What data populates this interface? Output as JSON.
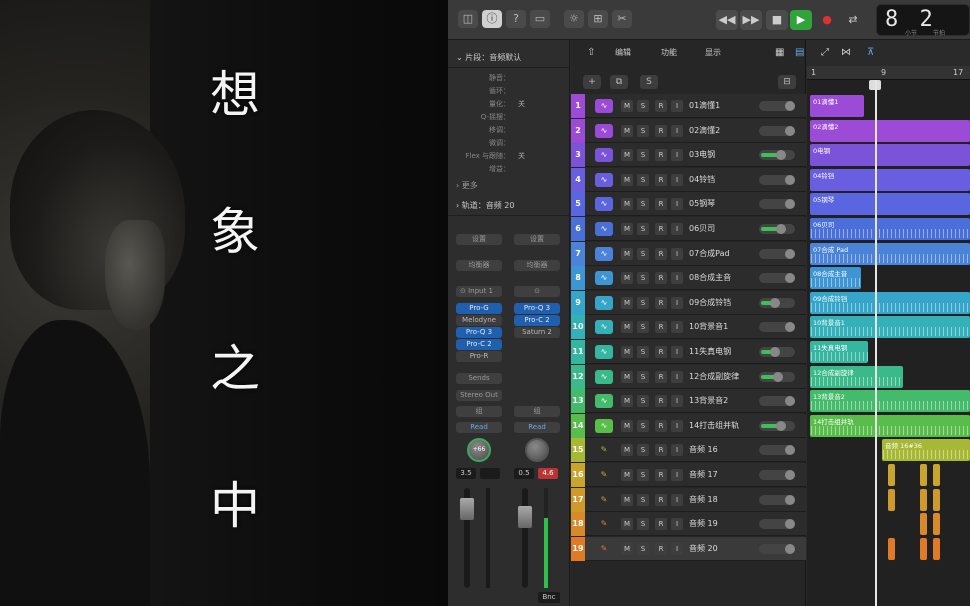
{
  "lyrics": [
    "想",
    "象",
    "之",
    "中"
  ],
  "toolbar": {
    "lcd_digits": "8 2",
    "lcd_small": [
      "小节",
      "节拍"
    ]
  },
  "inspector": {
    "region_header": "片段：音频默认",
    "region_rows": [
      {
        "k": "静音：",
        "v": ""
      },
      {
        "k": "循环：",
        "v": ""
      },
      {
        "k": "量化：",
        "v": "关"
      },
      {
        "k": "Q-摇摆：",
        "v": ""
      },
      {
        "k": "移调：",
        "v": ""
      },
      {
        "k": "微调：",
        "v": ""
      },
      {
        "k": "Flex 与跟随：",
        "v": "关"
      },
      {
        "k": "增益：",
        "v": ""
      }
    ],
    "more": "更多",
    "track_header": "轨道：音频 20",
    "left_strip": {
      "setting": "设置",
      "eq": "均衡器",
      "input": "Input 1",
      "plugins": [
        "Pro-G",
        "Melodyne",
        "Pro-Q 3",
        "Pro-C 2",
        "Pro-R"
      ],
      "sends": "Sends",
      "output": "Stereo Out",
      "group": "组",
      "auto": "Read",
      "knob": "+66",
      "vol": "3.5",
      "mode": ""
    },
    "right_strip": {
      "setting": "设置",
      "eq": "均衡器",
      "input": "",
      "plugins": [
        "Pro-Q 3",
        "Pro-C 2",
        "Saturn 2"
      ],
      "group": "组",
      "auto": "Read",
      "vol": "0.5",
      "peak": "4.6",
      "bnc": "Bnc"
    }
  },
  "tracks_toolbar": {
    "edit": "编辑",
    "functions": "功能",
    "view": "显示"
  },
  "ruler": [
    "1",
    "9",
    "17"
  ],
  "tracks": [
    {
      "num": "1",
      "name": "01滴懂1",
      "color": "#9b4bd6",
      "fader": 0.0
    },
    {
      "num": "2",
      "name": "02滴懂2",
      "color": "#9b4bd6",
      "fader": 0.0
    },
    {
      "num": "3",
      "name": "03电钢",
      "color": "#7b53d9",
      "fader": 0.6
    },
    {
      "num": "4",
      "name": "04铃铛",
      "color": "#6a5ee0",
      "fader": 0.0
    },
    {
      "num": "5",
      "name": "05钢琴",
      "color": "#5a65e0",
      "fader": 0.0
    },
    {
      "num": "6",
      "name": "06贝司",
      "color": "#4a6fd8",
      "fader": 0.6
    },
    {
      "num": "7",
      "name": "07合成Pad",
      "color": "#4a83d8",
      "fader": 0.0
    },
    {
      "num": "8",
      "name": "08合成主音",
      "color": "#3e95d4",
      "fader": 0.0
    },
    {
      "num": "9",
      "name": "09合成铃铛",
      "color": "#35a6c9",
      "fader": 0.4
    },
    {
      "num": "10",
      "name": "10背景音1",
      "color": "#33b0b8",
      "fader": 0.0
    },
    {
      "num": "11",
      "name": "11失真电钢",
      "color": "#35b6a0",
      "fader": 0.4
    },
    {
      "num": "12",
      "name": "12合成副旋律",
      "color": "#3ab98a",
      "fader": 0.5
    },
    {
      "num": "13",
      "name": "13背景音2",
      "color": "#44bb6b",
      "fader": 0.0
    },
    {
      "num": "14",
      "name": "14打击组并轨",
      "color": "#58bd4b",
      "fader": 0.6
    },
    {
      "num": "15",
      "name": "音频 16",
      "color": "#a6b834",
      "fader": 0.0
    },
    {
      "num": "16",
      "name": "音频 17",
      "color": "#c9a52c",
      "fader": 0.0
    },
    {
      "num": "17",
      "name": "音频 18",
      "color": "#d09a2a",
      "fader": 0.0
    },
    {
      "num": "18",
      "name": "音频 19",
      "color": "#d88a28",
      "fader": 0.0
    },
    {
      "num": "19",
      "name": "音频 20",
      "color": "#e07a26",
      "fader": 0.0
    }
  ],
  "regions": [
    {
      "label": "01滴懂1",
      "color": "#9b4bd6"
    },
    {
      "label": "02滴懂2",
      "color": "#9b4bd6"
    },
    {
      "label": "0电钢",
      "color": "#7b53d9"
    },
    {
      "label": "04铃铛",
      "color": "#6a5ee0"
    },
    {
      "label": "05钢琴",
      "color": "#5a65e0"
    },
    {
      "label": "06贝司",
      "color": "#4a6fd8"
    },
    {
      "label": "07合成 Pad",
      "color": "#4a83d8"
    },
    {
      "label": "08合成主音",
      "color": "#3e95d4"
    },
    {
      "label": "09合成铃铛",
      "color": "#35a6c9"
    },
    {
      "label": "10背景音1",
      "color": "#33b0b8"
    },
    {
      "label": "11失真电钢",
      "color": "#35b6a0"
    },
    {
      "label": "12合成副旋律",
      "color": "#3ab98a"
    },
    {
      "label": "13背景音2",
      "color": "#44bb6b"
    },
    {
      "label": "14打击组并轨",
      "color": "#58bd4b"
    },
    {
      "label": "音频 16#36",
      "color": "#a6b834"
    }
  ]
}
